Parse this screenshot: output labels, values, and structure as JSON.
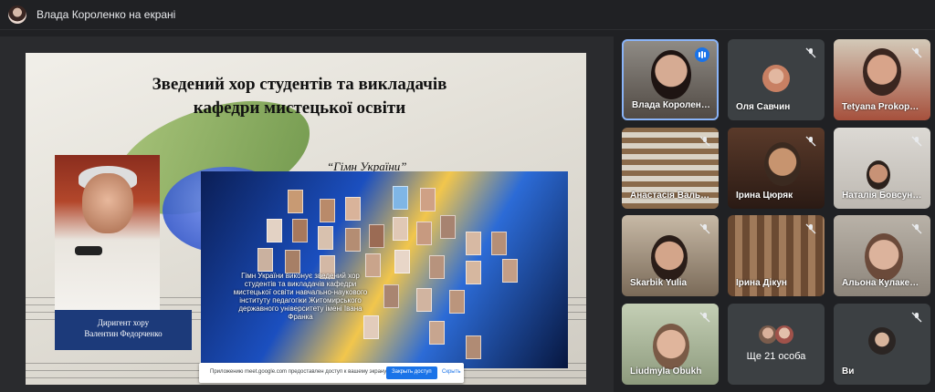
{
  "presenter_bar": {
    "title": "Влада Короленко на екрані"
  },
  "slide": {
    "title_line1": "Зведений хор студентів та викладачів",
    "title_line2": "кафедри мистецької освіти",
    "anthem_title": "“Гімн України”",
    "conductor_role": "Диригент хору",
    "conductor_name": "Валентин Федорченко",
    "video_caption": "Гімн України виконує зведений хор студентів та викладачів кафедри мистецької освіти навчально-наукового інституту педагогіки Житомирського державного університету імені Івана Франка"
  },
  "share_notice": {
    "message": "Приложению meet.google.com предоставлен доступ к вашему экрану.",
    "stop_label": "Закрыть доступ",
    "hide_label": "Скрыть"
  },
  "participants": [
    {
      "name": "Влада Королен…",
      "speaking": true
    },
    {
      "name": "Оля Савчин",
      "muted": true
    },
    {
      "name": "Tetyana Prokop…",
      "muted": true
    },
    {
      "name": "Анастасія Валь…",
      "muted": true
    },
    {
      "name": "Ірина Цюряк",
      "muted": true
    },
    {
      "name": "Наталія Бовсун…",
      "muted": true
    },
    {
      "name": "Skarbik Yulia",
      "muted": true
    },
    {
      "name": "Ірина Дікун",
      "muted": true
    },
    {
      "name": "Альона Кулаке…",
      "muted": true
    },
    {
      "name": "Liudmyla Obukh",
      "muted": true
    },
    {
      "name": "Ще 21 особа"
    },
    {
      "name": "Ви",
      "muted": true
    }
  ],
  "colors": {
    "active_border": "#8ab4f8",
    "accent": "#1a73e8",
    "background": "#202124"
  }
}
